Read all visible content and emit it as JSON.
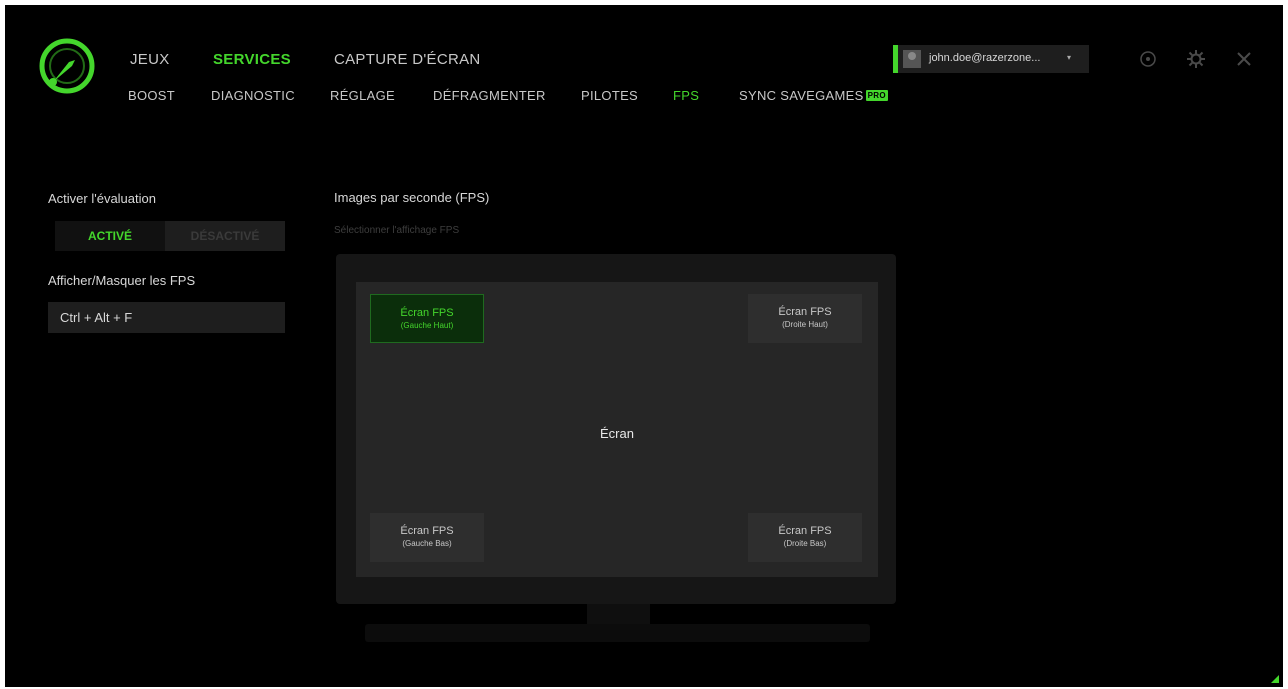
{
  "nav": {
    "top": [
      "JEUX",
      "SERVICES",
      "CAPTURE D'ÉCRAN"
    ],
    "sub": [
      "BOOST",
      "DIAGNOSTIC",
      "RÉGLAGE",
      "DÉFRAGMENTER",
      "PILOTES",
      "FPS",
      "SYNC SAVEGAMES"
    ],
    "pro_badge": "PRO"
  },
  "user": {
    "email": "john.doe@razerzone...",
    "caret": "▾"
  },
  "left": {
    "enable_label": "Activer l'évaluation",
    "toggle_on": "ACTIVÉ",
    "toggle_off": "DÉSACTIVÉ",
    "toggle_state": "on",
    "show_hide_label": "Afficher/Masquer les FPS",
    "shortcut": "Ctrl + Alt + F"
  },
  "fps": {
    "title": "Images par seconde (FPS)",
    "subtitle": "Sélectionner l'affichage FPS",
    "screen_label": "Écran",
    "positions": [
      {
        "title": "Écran FPS",
        "sub": "(Gauche Haut)",
        "selected": true
      },
      {
        "title": "Écran FPS",
        "sub": "(Droite Haut)",
        "selected": false
      },
      {
        "title": "Écran FPS",
        "sub": "(Gauche Bas)",
        "selected": false
      },
      {
        "title": "Écran FPS",
        "sub": "(Droite Bas)",
        "selected": false
      }
    ]
  },
  "icons": [
    "app-logo-icon",
    "avatar-icon",
    "help-icon",
    "settings-gear-icon",
    "close-icon",
    "resize-grip-icon"
  ],
  "colors": {
    "accent": "#44d62c",
    "background": "#000000",
    "panel": "#1e1e1e"
  }
}
